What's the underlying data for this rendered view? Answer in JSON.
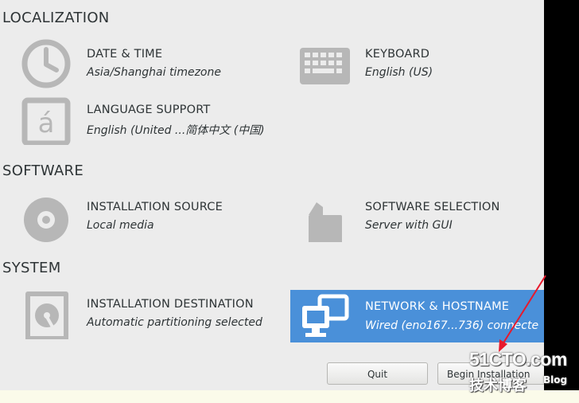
{
  "sections": {
    "localization": "LOCALIZATION",
    "software": "SOFTWARE",
    "system": "SYSTEM"
  },
  "spokes": {
    "date_time": {
      "title": "DATE & TIME",
      "status": "Asia/Shanghai timezone",
      "icon": "clock-icon"
    },
    "keyboard": {
      "title": "KEYBOARD",
      "status": "English (US)",
      "icon": "keyboard-icon"
    },
    "language": {
      "title": "LANGUAGE SUPPORT",
      "status": "English (United ...简体中文 (中国)",
      "icon": "language-icon"
    },
    "install_source": {
      "title": "INSTALLATION SOURCE",
      "status": "Local media",
      "icon": "disc-icon"
    },
    "software_selection": {
      "title": "SOFTWARE SELECTION",
      "status": "Server with GUI",
      "icon": "package-icon"
    },
    "install_destination": {
      "title": "INSTALLATION DESTINATION",
      "status": "Automatic partitioning selected",
      "icon": "harddisk-icon"
    },
    "network": {
      "title": "NETWORK & HOSTNAME",
      "status": "Wired (eno167...736) connecte",
      "icon": "network-icon"
    }
  },
  "buttons": {
    "quit": "Quit",
    "begin": "Begin Installation"
  },
  "watermark": {
    "main": "51CTO.com",
    "sub": "技术博客",
    "blog": "Blog"
  },
  "colors": {
    "accent": "#4a90d9",
    "icon_gray": "#b7b7b7",
    "arrow": "#e8192c"
  }
}
